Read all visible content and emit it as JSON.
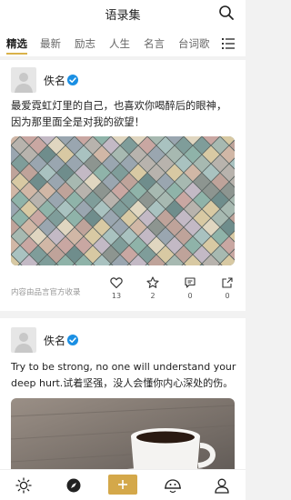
{
  "header": {
    "title": "语录集"
  },
  "tabs": [
    {
      "label": "精选"
    },
    {
      "label": "最新"
    },
    {
      "label": "励志"
    },
    {
      "label": "人生"
    },
    {
      "label": "名言"
    },
    {
      "label": "台词歌"
    }
  ],
  "colors": {
    "accent": "#d4a84a",
    "verified": "#1a8fe3"
  },
  "posts": [
    {
      "author": "佚名",
      "quote_line1": "最爱霓虹灯里的自己，也喜欢你喝醉后的眼神，",
      "quote_line2": "因为那里面全是对我的欲望！",
      "source": "内容由品言官方收录",
      "likes": "13",
      "favorites": "2",
      "comments": "0",
      "shares": "0"
    },
    {
      "author": "佚名",
      "quote_line1": "Try to be strong, no one will understand your",
      "quote_line2": "deep hurt.试着坚强，没人会懂你内心深处的伤。"
    }
  ],
  "tabbar": {
    "items": [
      "discover-icon",
      "compass-icon",
      "plus-icon",
      "fortune-icon",
      "profile-icon"
    ]
  }
}
